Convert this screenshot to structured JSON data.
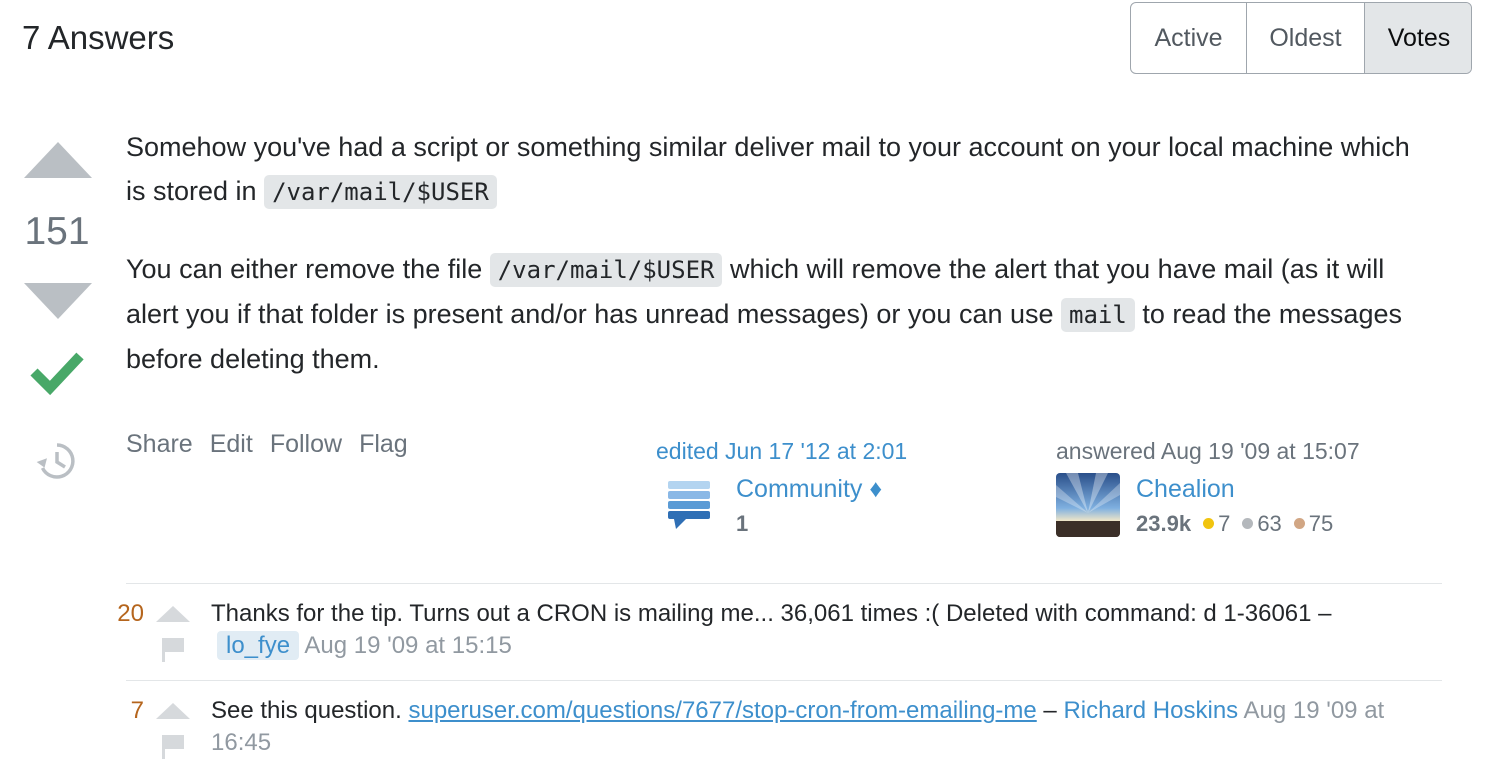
{
  "header": {
    "answers_count": "7 Answers"
  },
  "sort": {
    "options": [
      "Active",
      "Oldest",
      "Votes"
    ],
    "selected": "Votes"
  },
  "answer": {
    "vote_count": "151",
    "body": {
      "p1_text": "Somehow you've had a script or something similar deliver mail to your account on your local machine which is stored in ",
      "p1_code": "/var/mail/$USER",
      "p2_text_a": "You can either remove the file ",
      "p2_code_a": "/var/mail/$USER",
      "p2_text_b": " which will remove the alert that you have mail (as it will alert you if that folder is present and/or has unread messages) or you can use ",
      "p2_code_b": "mail",
      "p2_text_c": " to read the messages before deleting them."
    },
    "menu": {
      "share": "Share",
      "edit": "Edit",
      "follow": "Follow",
      "flag": "Flag"
    },
    "edited": {
      "action": "edited Jun 17 '12 at 2:01",
      "user": "Community ♦",
      "rep": "1"
    },
    "owner": {
      "action": "answered Aug 19 '09 at 15:07",
      "user": "Chealion",
      "rep": "23.9k",
      "gold": "7",
      "silver": "63",
      "bronze": "75"
    }
  },
  "comments": [
    {
      "score": "20",
      "text": "Thanks for the tip. Turns out a CRON is mailing me... 36,061 times :( Deleted with command: d 1-36061 –",
      "user": "lo_fye",
      "date": "Aug 19 '09 at 15:15"
    },
    {
      "score": "7",
      "text": "See this question. ",
      "link": "superuser.com/questions/7677/stop-cron-from-emailing-me",
      "sep": " – ",
      "user": "Richard Hoskins",
      "date": " Aug 19 '09 at 16:45"
    }
  ],
  "colors": {
    "link": "#3d8fcc",
    "accepted": "#48a868",
    "gold": "#f1c40f",
    "silver": "#b4b8bc",
    "bronze": "#d1a684"
  }
}
